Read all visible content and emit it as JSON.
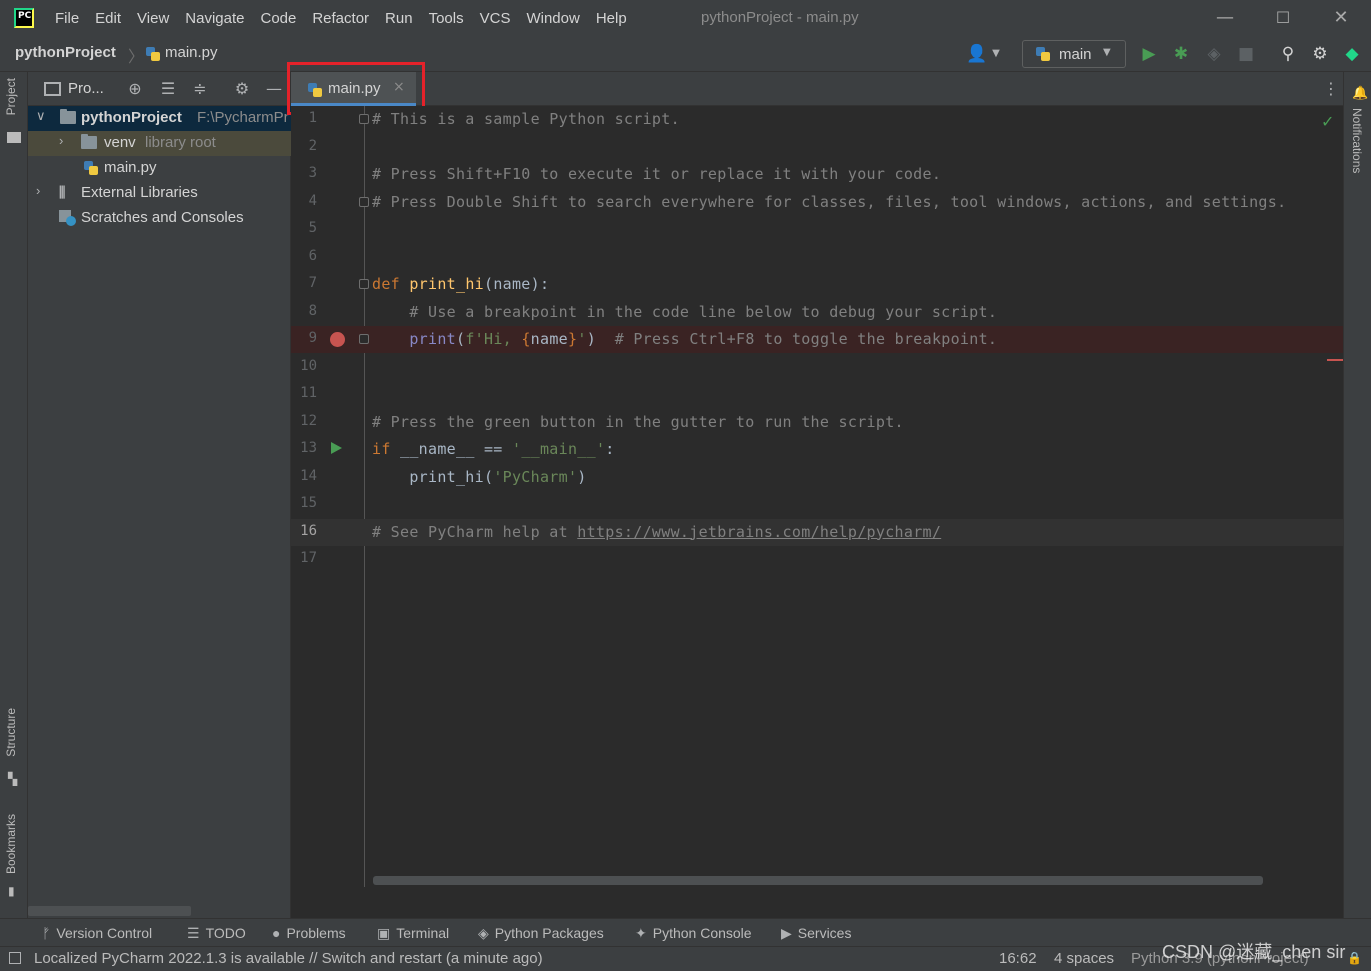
{
  "menu": [
    "File",
    "Edit",
    "View",
    "Navigate",
    "Code",
    "Refactor",
    "Run",
    "Tools",
    "VCS",
    "Window",
    "Help"
  ],
  "window_title": "pythonProject - main.py",
  "breadcrumb": {
    "project": "pythonProject",
    "file": "main.py"
  },
  "run_config": "main",
  "left_stripe": {
    "project": "Project",
    "structure": "Structure",
    "bookmarks": "Bookmarks"
  },
  "right_stripe": {
    "notifications": "Notifications"
  },
  "project_panel": {
    "title": "Pro...",
    "tree": {
      "root_name": "pythonProject",
      "root_path": "F:\\PycharmPr",
      "venv_name": "venv",
      "venv_note": "library root",
      "file": "main.py",
      "external": "External Libraries",
      "scratches": "Scratches and Consoles"
    }
  },
  "editor_tab": {
    "label": "main.py",
    "close": "×"
  },
  "code": {
    "line_numbers": [
      "1",
      "2",
      "3",
      "4",
      "5",
      "6",
      "7",
      "8",
      "9",
      "10",
      "11",
      "12",
      "13",
      "14",
      "15",
      "16",
      "17"
    ],
    "l1": "# This is a sample Python script.",
    "l3": "# Press Shift+F10 to execute it or replace it with your code.",
    "l4": "# Press Double Shift to search everywhere for classes, files, tool windows, actions, and settings.",
    "l7_kw": "def ",
    "l7_fn": "print_hi",
    "l7_rest": "(name):",
    "l8": "    # Use a breakpoint in the code line below to debug your script.",
    "l9_indent": "    ",
    "l9_fn": "print",
    "l9_open": "(",
    "l9_str1": "f'Hi, ",
    "l9_brace1": "{",
    "l9_name": "name",
    "l9_brace2": "}",
    "l9_str2": "'",
    "l9_close": ")",
    "l9_cmt": "  # Press Ctrl+F8 to toggle the breakpoint.",
    "l12": "# Press the green button in the gutter to run the script.",
    "l13_kw": "if ",
    "l13_rest": "__name__ == ",
    "l13_str": "'__main__'",
    "l13_colon": ":",
    "l14_call": "    print_hi(",
    "l14_str": "'PyCharm'",
    "l14_close": ")",
    "l16_cmt": "# See PyCharm help at ",
    "l16_link": "https://www.jetbrains.com/help/pycharm/"
  },
  "tool_windows": [
    "Version Control",
    "TODO",
    "Problems",
    "Terminal",
    "Python Packages",
    "Python Console",
    "Services"
  ],
  "status": {
    "message": "Localized PyCharm 2022.1.3 is available // Switch and restart (a minute ago)",
    "position": "16:62",
    "indent": "4 spaces",
    "interpreter": "Python 3.9 (pythonProject)"
  },
  "watermark": "CSDN @迷藏_chen sir",
  "colors": {
    "highlight": "#e5222a",
    "breakpoint": "#c75450",
    "run": "#499c54"
  }
}
